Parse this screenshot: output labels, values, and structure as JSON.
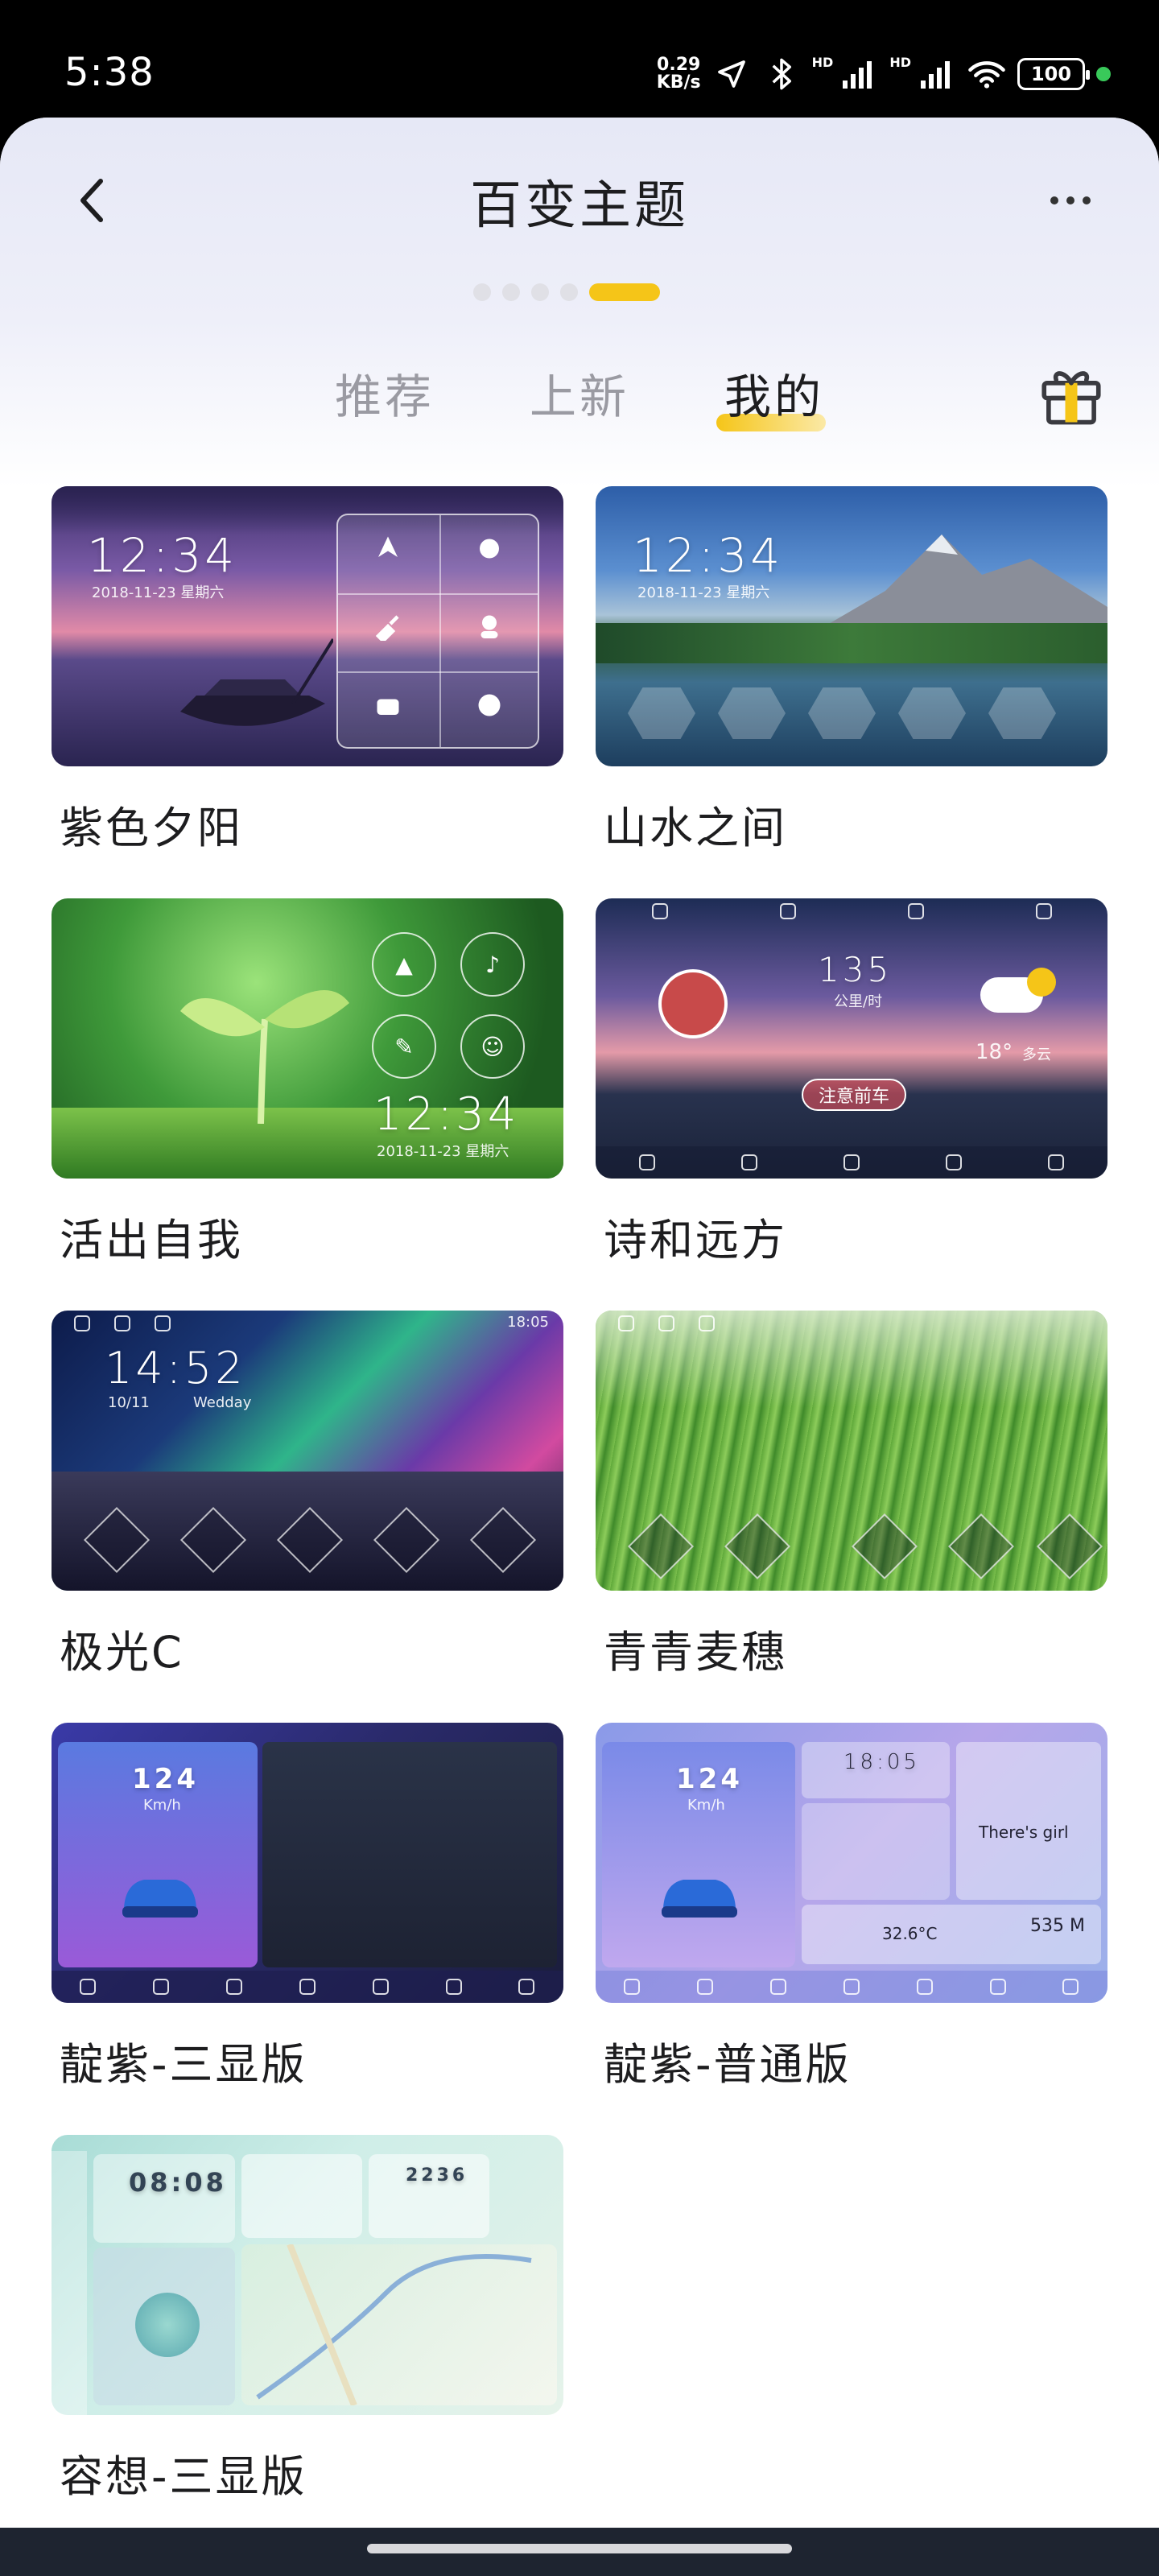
{
  "status_bar": {
    "time": "5:38",
    "net_speed_value": "0.29",
    "net_speed_unit": "KB/s",
    "hd1": "HD",
    "hd2": "HD",
    "battery": "100",
    "icons": [
      "location-icon",
      "bluetooth-icon",
      "signal-icon",
      "signal-icon",
      "wifi-icon",
      "battery-icon"
    ]
  },
  "header": {
    "title": "百变主题"
  },
  "pager": {
    "count": 5,
    "active_index": 4
  },
  "tabs": [
    {
      "label": "推荐",
      "active": false
    },
    {
      "label": "上新",
      "active": false
    },
    {
      "label": "我的",
      "active": true
    }
  ],
  "themes": [
    {
      "name": "紫色夕阳",
      "clock": "12:34",
      "date": "2018-11-23  星期六"
    },
    {
      "name": "山水之间",
      "clock": "12:34",
      "date": "2018-11-23  星期六"
    },
    {
      "name": "活出自我",
      "clock": "12:34",
      "date": "2018-11-23  星期六"
    },
    {
      "name": "诗和远方",
      "speed": "135",
      "speed_unit": "公里/时",
      "temp": "18°",
      "weather": "多云",
      "warning": "注意前车"
    },
    {
      "name": "极光C",
      "clock": "14:52",
      "date": "10/11",
      "day": "Wedday",
      "time_right": "18:05"
    },
    {
      "name": "青青麦穗"
    },
    {
      "name": "靛紫-三显版",
      "speed": "124",
      "speed_unit": "Km/h"
    },
    {
      "name": "靛紫-普通版",
      "speed": "124",
      "speed_unit": "Km/h",
      "clock": "18:05",
      "song": "There's girl",
      "temp": "32.6°C",
      "dist": "535 M"
    },
    {
      "name": "容想-三显版",
      "clock": "08:08",
      "dist": "2236"
    }
  ],
  "colors": {
    "accent": "#f5c518",
    "title_text": "#1d1d1f",
    "tab_inactive": "#9a9aa2"
  }
}
